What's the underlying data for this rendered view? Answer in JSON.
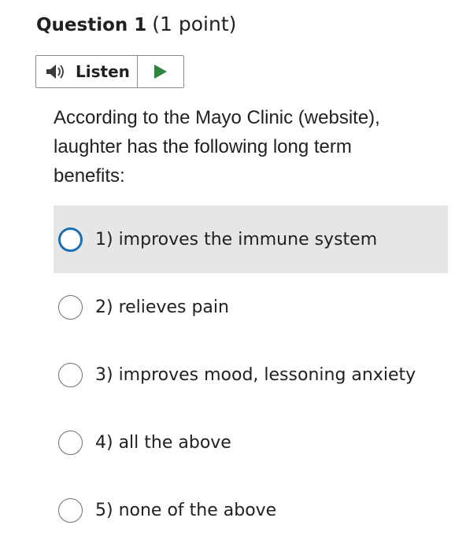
{
  "question": {
    "title": "Question 1",
    "points": "(1 point)",
    "text": "According to the Mayo Clinic (website), laughter has the following long term benefits:"
  },
  "listen": {
    "label": "Listen",
    "speaker_icon": "speaker-icon",
    "play_icon": "play-icon",
    "play_color": "#2e8540"
  },
  "options": [
    {
      "label": "1) improves the immune system",
      "highlighted": true
    },
    {
      "label": "2) relieves pain",
      "highlighted": false
    },
    {
      "label": "3) improves mood, lessoning anxiety",
      "highlighted": false
    },
    {
      "label": "4) all the above",
      "highlighted": false
    },
    {
      "label": "5) none of the above",
      "highlighted": false
    }
  ],
  "colors": {
    "focus_ring": "#1d6fb0",
    "hover_bg": "#e6e6e6"
  }
}
